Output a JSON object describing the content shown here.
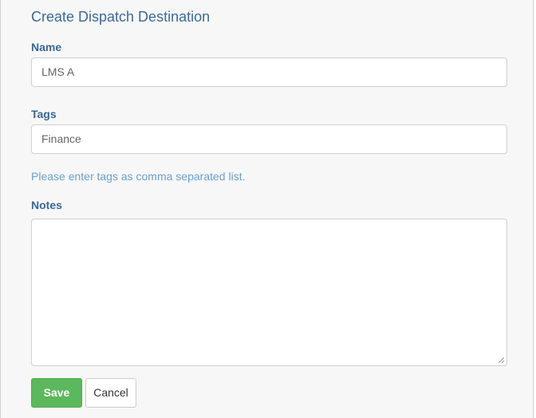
{
  "form": {
    "title": "Create Dispatch Destination",
    "name_label": "Name",
    "name_value": "LMS A",
    "tags_label": "Tags",
    "tags_value": "Finance",
    "tags_help": "Please enter tags as comma separated list.",
    "notes_label": "Notes",
    "notes_value": ""
  },
  "actions": {
    "save_label": "Save",
    "cancel_label": "Cancel"
  },
  "colors": {
    "title": "#3c6a96",
    "label": "#3b6791",
    "help_text": "#6a9fca",
    "save_button": "#5cb85c"
  }
}
